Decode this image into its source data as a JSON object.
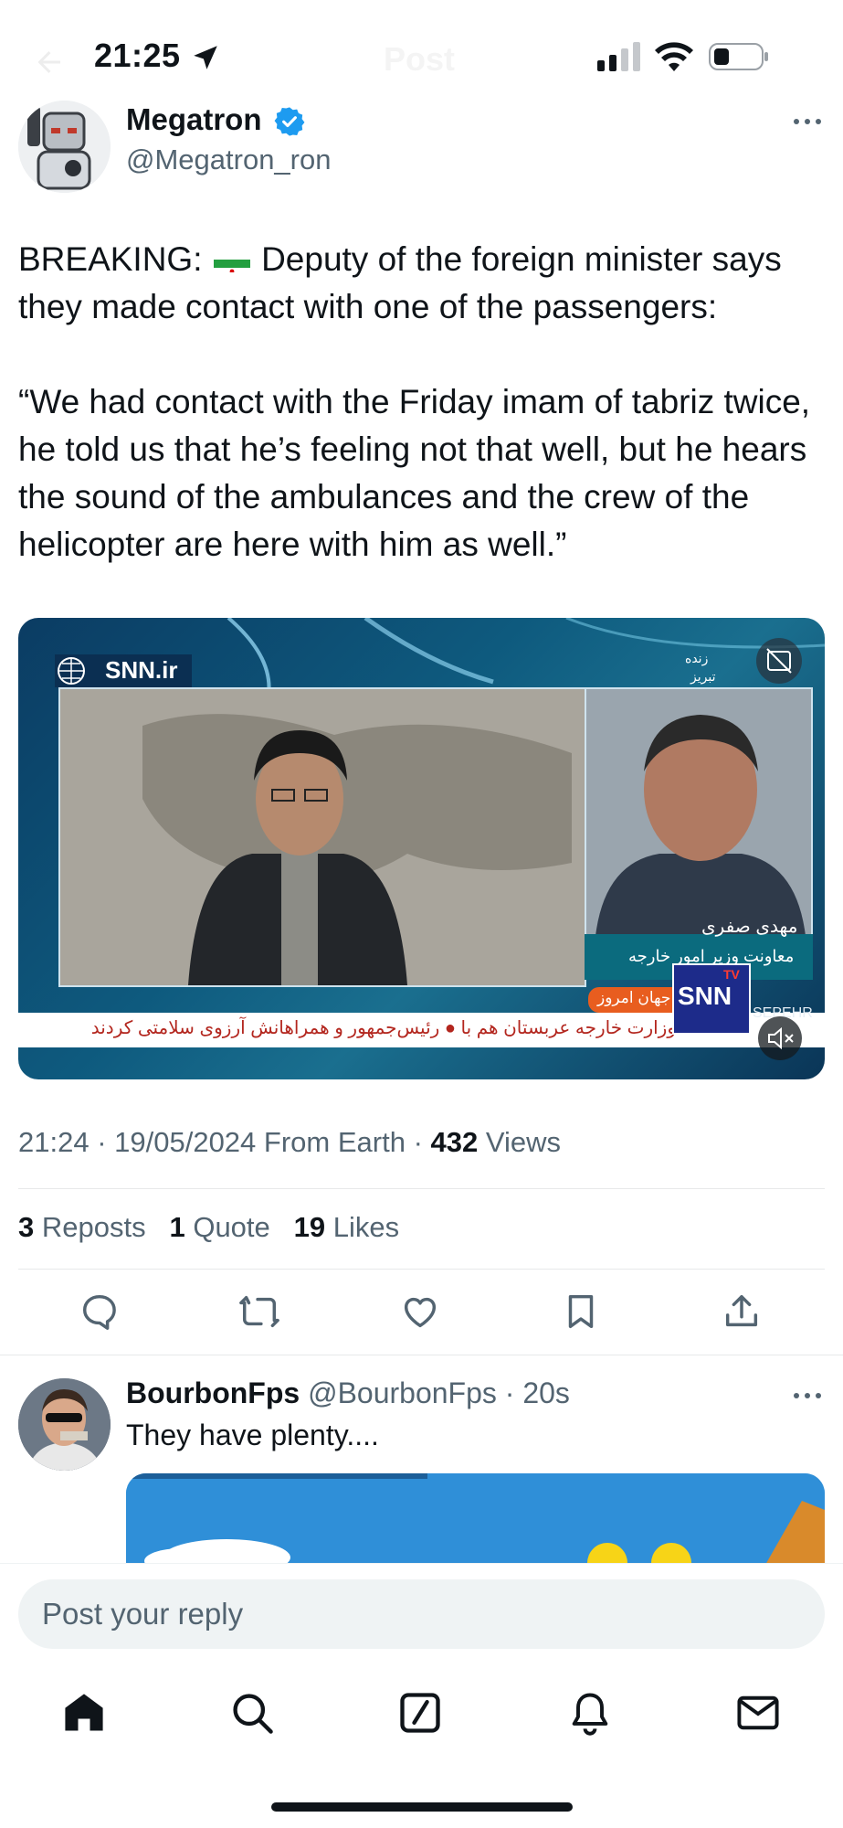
{
  "status_bar": {
    "time": "21:25"
  },
  "ghost_header": {
    "title": "Post"
  },
  "tweet": {
    "author_name": "Megatron",
    "author_handle": "@Megatron_ron",
    "line1_prefix": "BREAKING:",
    "line1_suffix": "Deputy of the foreign minister says",
    "line2": "they made contact with one of the passengers:",
    "quote": "“We had contact with the Friday imam of tabriz twice, he told us that he’s feeling not that well, but he hears the sound of the ambulances and the crew of the helicopter are here with him as well.”",
    "flag_icon": "iran-flag-icon"
  },
  "media": {
    "logo": "SNN.ir",
    "live_label": "زنده",
    "city_label": "تبریز",
    "caption_name": "مهدی صفری",
    "caption_role": "معاونت وزیر امور خارجه",
    "today_label": "جهان امروز",
    "tv_name": "SNN",
    "tv_badge": "TV",
    "sepehr": "SEPEHR",
    "ticker": "وزارت خارجه عربستان هم با  ●  رئیس‌جمهور و همراهانش آرزوی سلامتی کردند"
  },
  "meta": {
    "time": "21:24",
    "date": "19/05/2024",
    "source": "From Earth",
    "views_count": "432",
    "views_label": "Views"
  },
  "stats": {
    "reposts_count": "3",
    "reposts_label": "Reposts",
    "quotes_count": "1",
    "quotes_label": "Quote",
    "likes_count": "19",
    "likes_label": "Likes"
  },
  "reply": {
    "name": "BourbonFps",
    "handle": "@BourbonFps",
    "time": "20s",
    "text": "They have plenty...."
  },
  "composer": {
    "placeholder": "Post your reply"
  },
  "colors": {
    "accent": "#1d9bf0",
    "text": "#0f1419",
    "secondary": "#536471",
    "divider": "#e7e9ea"
  }
}
